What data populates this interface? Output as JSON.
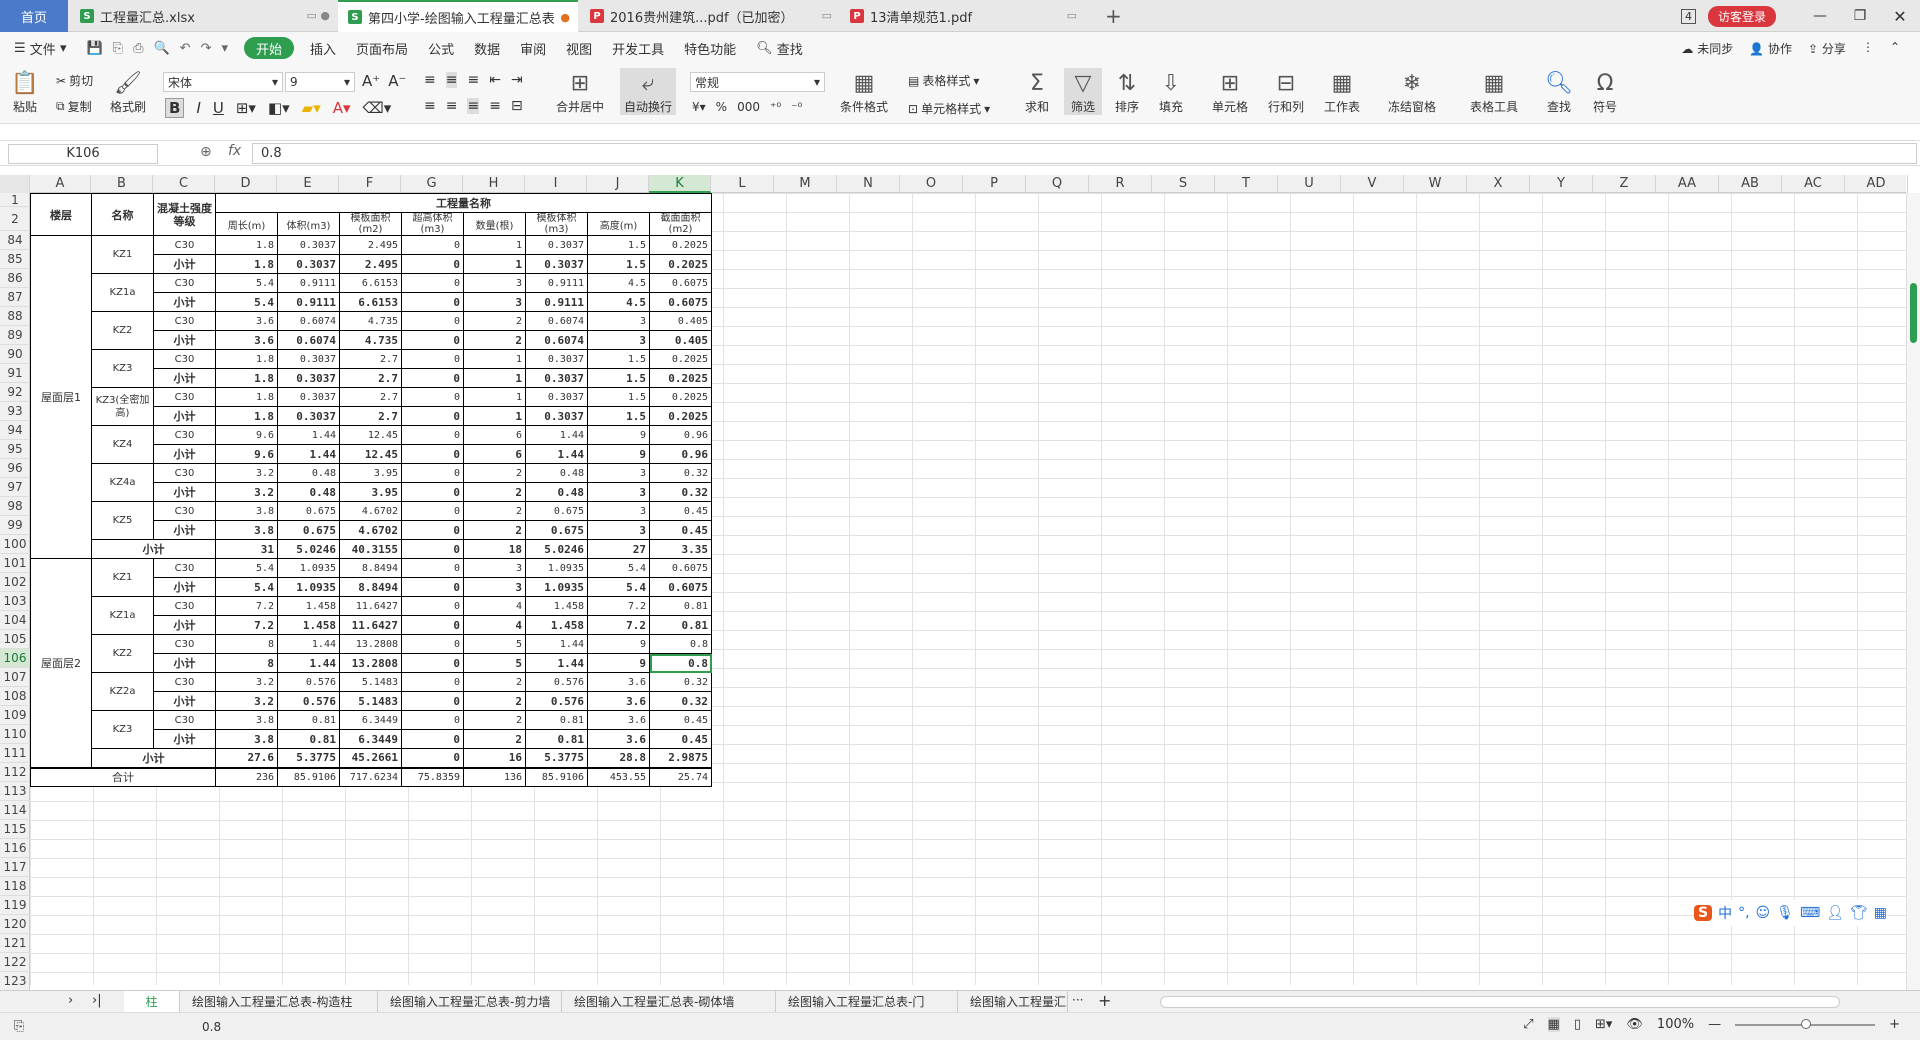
{
  "tabs": {
    "home": "首页",
    "items": [
      {
        "label": "工程量汇总.xlsx",
        "icon": "S",
        "color": "#2e9d4f"
      },
      {
        "label": "第四小学-绘图输入工程量汇总表",
        "icon": "S",
        "color": "#2e9d4f"
      },
      {
        "label": "2016贵州建筑...pdf（已加密）",
        "icon": "P",
        "color": "#d9363e"
      },
      {
        "label": "13清单规范1.pdf",
        "icon": "P",
        "color": "#d9363e"
      }
    ],
    "badge": "4",
    "visitor": "访客登录"
  },
  "menu": {
    "file": "文件",
    "items": [
      "开始",
      "插入",
      "页面布局",
      "公式",
      "数据",
      "审阅",
      "视图",
      "开发工具",
      "特色功能"
    ],
    "search": "查找",
    "sync": "未同步",
    "collab": "协作",
    "share": "分享"
  },
  "ribbon": {
    "paste": "粘贴",
    "cut": "剪切",
    "copy": "复制",
    "format_painter": "格式刷",
    "font": "宋体",
    "size": "9",
    "merge": "合并居中",
    "wrap": "自动换行",
    "number_format": "常规",
    "cond_format": "条件格式",
    "table_style": "表格样式",
    "cell_style": "单元格样式",
    "sum": "求和",
    "filter": "筛选",
    "sort": "排序",
    "fill": "填充",
    "cell": "单元格",
    "rowcol": "行和列",
    "worksheet": "工作表",
    "freeze": "冻结窗格",
    "table_tools": "表格工具",
    "find": "查找",
    "symbol": "符号"
  },
  "formula": {
    "cell_ref": "K106",
    "fx": "fx",
    "value": "0.8"
  },
  "columns": [
    "A",
    "B",
    "C",
    "D",
    "E",
    "F",
    "G",
    "H",
    "I",
    "J",
    "K",
    "L",
    "M",
    "N",
    "O",
    "P",
    "Q",
    "R",
    "S",
    "T",
    "U",
    "V",
    "W",
    "X",
    "Y",
    "Z",
    "AA",
    "AB",
    "AC",
    "AD"
  ],
  "rows_top": [
    "1",
    "2"
  ],
  "row_numbers": [
    "84",
    "85",
    "86",
    "87",
    "88",
    "89",
    "90",
    "91",
    "92",
    "93",
    "94",
    "95",
    "96",
    "97",
    "98",
    "99",
    "100",
    "101",
    "102",
    "103",
    "104",
    "105",
    "106",
    "107",
    "108",
    "109",
    "110",
    "111",
    "112",
    "113",
    "114",
    "115",
    "116",
    "117",
    "118",
    "119",
    "120",
    "121",
    "122",
    "123"
  ],
  "header": {
    "floor": "楼层",
    "name": "名称",
    "grade": "混凝土强度等级",
    "group": "工程量名称",
    "d": "周长(m)",
    "e": "体积(m3)",
    "f": "模板面积(m2)",
    "g": "超高体积(m3)",
    "h": "数量(根)",
    "i": "模板体积(m3)",
    "j": "高度(m)",
    "k": "截面面积(m2)"
  },
  "floor1": "屋面层1",
  "floor2": "屋面层2",
  "rows": [
    {
      "name": "KZ1",
      "c": "C30",
      "v": [
        "1.8",
        "0.3037",
        "2.495",
        "0",
        "1",
        "0.3037",
        "1.5",
        "0.2025"
      ]
    },
    {
      "c": "小计",
      "bold": true,
      "v": [
        "1.8",
        "0.3037",
        "2.495",
        "0",
        "1",
        "0.3037",
        "1.5",
        "0.2025"
      ]
    },
    {
      "name": "KZ1a",
      "c": "C30",
      "v": [
        "5.4",
        "0.9111",
        "6.6153",
        "0",
        "3",
        "0.9111",
        "4.5",
        "0.6075"
      ]
    },
    {
      "c": "小计",
      "bold": true,
      "v": [
        "5.4",
        "0.9111",
        "6.6153",
        "0",
        "3",
        "0.9111",
        "4.5",
        "0.6075"
      ]
    },
    {
      "name": "KZ2",
      "c": "C30",
      "v": [
        "3.6",
        "0.6074",
        "4.735",
        "0",
        "2",
        "0.6074",
        "3",
        "0.405"
      ]
    },
    {
      "c": "小计",
      "bold": true,
      "v": [
        "3.6",
        "0.6074",
        "4.735",
        "0",
        "2",
        "0.6074",
        "3",
        "0.405"
      ]
    },
    {
      "name": "KZ3",
      "c": "C30",
      "v": [
        "1.8",
        "0.3037",
        "2.7",
        "0",
        "1",
        "0.3037",
        "1.5",
        "0.2025"
      ]
    },
    {
      "c": "小计",
      "bold": true,
      "v": [
        "1.8",
        "0.3037",
        "2.7",
        "0",
        "1",
        "0.3037",
        "1.5",
        "0.2025"
      ]
    },
    {
      "name": "KZ3(全密加高)",
      "c": "C30",
      "v": [
        "1.8",
        "0.3037",
        "2.7",
        "0",
        "1",
        "0.3037",
        "1.5",
        "0.2025"
      ]
    },
    {
      "c": "小计",
      "bold": true,
      "v": [
        "1.8",
        "0.3037",
        "2.7",
        "0",
        "1",
        "0.3037",
        "1.5",
        "0.2025"
      ]
    },
    {
      "name": "KZ4",
      "c": "C30",
      "v": [
        "9.6",
        "1.44",
        "12.45",
        "0",
        "6",
        "1.44",
        "9",
        "0.96"
      ]
    },
    {
      "c": "小计",
      "bold": true,
      "v": [
        "9.6",
        "1.44",
        "12.45",
        "0",
        "6",
        "1.44",
        "9",
        "0.96"
      ]
    },
    {
      "name": "KZ4a",
      "c": "C30",
      "v": [
        "3.2",
        "0.48",
        "3.95",
        "0",
        "2",
        "0.48",
        "3",
        "0.32"
      ]
    },
    {
      "c": "小计",
      "bold": true,
      "v": [
        "3.2",
        "0.48",
        "3.95",
        "0",
        "2",
        "0.48",
        "3",
        "0.32"
      ]
    },
    {
      "name": "KZ5",
      "c": "C30",
      "v": [
        "3.8",
        "0.675",
        "4.6702",
        "0",
        "2",
        "0.675",
        "3",
        "0.45"
      ]
    },
    {
      "c": "小计",
      "bold": true,
      "v": [
        "3.8",
        "0.675",
        "4.6702",
        "0",
        "2",
        "0.675",
        "3",
        "0.45"
      ]
    },
    {
      "sub": "小计",
      "bold": true,
      "v": [
        "31",
        "5.0246",
        "40.3155",
        "0",
        "18",
        "5.0246",
        "27",
        "3.35"
      ]
    },
    {
      "name": "KZ1",
      "c": "C30",
      "v": [
        "5.4",
        "1.0935",
        "8.8494",
        "0",
        "3",
        "1.0935",
        "5.4",
        "0.6075"
      ]
    },
    {
      "c": "小计",
      "bold": true,
      "v": [
        "5.4",
        "1.0935",
        "8.8494",
        "0",
        "3",
        "1.0935",
        "5.4",
        "0.6075"
      ]
    },
    {
      "name": "KZ1a",
      "c": "C30",
      "v": [
        "7.2",
        "1.458",
        "11.6427",
        "0",
        "4",
        "1.458",
        "7.2",
        "0.81"
      ]
    },
    {
      "c": "小计",
      "bold": true,
      "v": [
        "7.2",
        "1.458",
        "11.6427",
        "0",
        "4",
        "1.458",
        "7.2",
        "0.81"
      ]
    },
    {
      "name": "KZ2",
      "c": "C30",
      "v": [
        "8",
        "1.44",
        "13.2808",
        "0",
        "5",
        "1.44",
        "9",
        "0.8"
      ]
    },
    {
      "c": "小计",
      "bold": true,
      "v": [
        "8",
        "1.44",
        "13.2808",
        "0",
        "5",
        "1.44",
        "9",
        "0.8"
      ]
    },
    {
      "name": "KZ2a",
      "c": "C30",
      "v": [
        "3.2",
        "0.576",
        "5.1483",
        "0",
        "2",
        "0.576",
        "3.6",
        "0.32"
      ]
    },
    {
      "c": "小计",
      "bold": true,
      "v": [
        "3.2",
        "0.576",
        "5.1483",
        "0",
        "2",
        "0.576",
        "3.6",
        "0.32"
      ]
    },
    {
      "name": "KZ3",
      "c": "C30",
      "v": [
        "3.8",
        "0.81",
        "6.3449",
        "0",
        "2",
        "0.81",
        "3.6",
        "0.45"
      ]
    },
    {
      "c": "小计",
      "bold": true,
      "v": [
        "3.8",
        "0.81",
        "6.3449",
        "0",
        "2",
        "0.81",
        "3.6",
        "0.45"
      ]
    },
    {
      "sub": "小计",
      "bold": true,
      "v": [
        "27.6",
        "5.3775",
        "45.2661",
        "0",
        "16",
        "5.3775",
        "28.8",
        "2.9875"
      ]
    },
    {
      "total": "合计",
      "v": [
        "236",
        "85.9106",
        "717.6234",
        "75.8359",
        "136",
        "85.9106",
        "453.55",
        "25.74"
      ]
    }
  ],
  "sheets": [
    "柱",
    "绘图输入工程量汇总表-构造柱",
    "绘图输入工程量汇总表-剪力墙",
    "绘图输入工程量汇总表-砌体墙",
    "绘图输入工程量汇总表-门",
    "绘图输入工程量汇总表-窗"
  ],
  "status": {
    "value": "0.8",
    "zoom": "100%"
  },
  "ime": {
    "label": "中"
  }
}
